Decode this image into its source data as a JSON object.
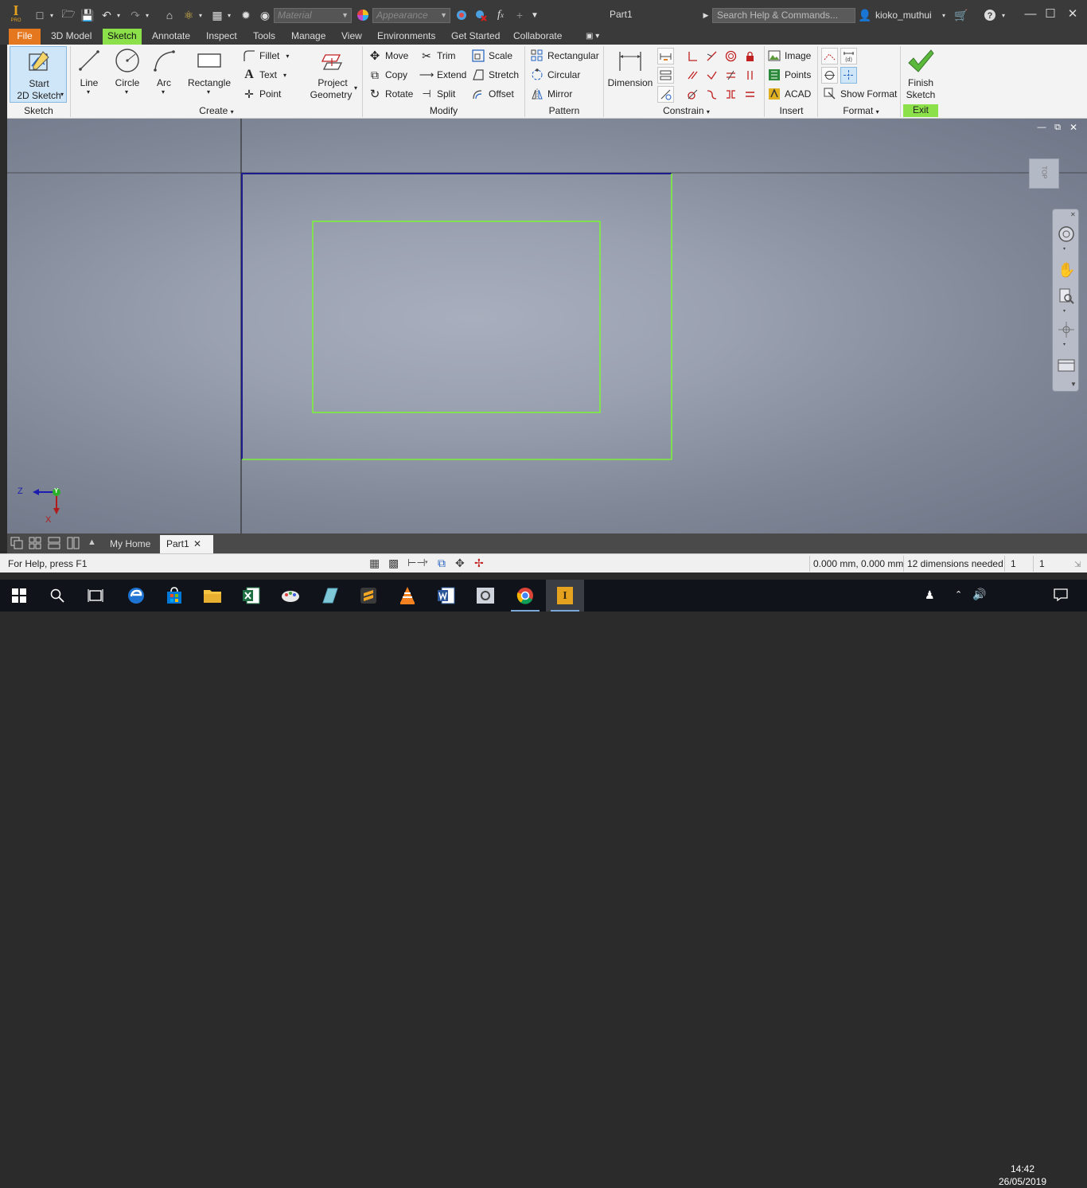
{
  "app": {
    "logo_text": "I",
    "logo_sub": "PRO",
    "title": "Part1",
    "material_placeholder": "Material",
    "appearance_placeholder": "Appearance",
    "fx_label": "f",
    "search_placeholder": "Search Help & Commands...",
    "username": "kioko_muthui"
  },
  "menu_tabs": [
    "File",
    "3D Model",
    "Sketch",
    "Annotate",
    "Inspect",
    "Tools",
    "Manage",
    "View",
    "Environments",
    "Get Started",
    "Collaborate"
  ],
  "ribbon": {
    "sketch_panel": {
      "start_label_1": "Start",
      "start_label_2": "2D Sketch",
      "title": "Sketch"
    },
    "create_panel": {
      "line": "Line",
      "circle": "Circle",
      "arc": "Arc",
      "rectangle": "Rectangle",
      "fillet": "Fillet",
      "text": "Text",
      "point": "Point",
      "project_1": "Project",
      "project_2": "Geometry",
      "title": "Create"
    },
    "modify_panel": {
      "move": "Move",
      "copy": "Copy",
      "rotate": "Rotate",
      "trim": "Trim",
      "extend": "Extend",
      "split": "Split",
      "scale": "Scale",
      "stretch": "Stretch",
      "offset": "Offset",
      "title": "Modify"
    },
    "pattern_panel": {
      "rectangular": "Rectangular",
      "circular": "Circular",
      "mirror": "Mirror",
      "title": "Pattern"
    },
    "constrain_panel": {
      "dimension": "Dimension",
      "title": "Constrain"
    },
    "insert_panel": {
      "image": "Image",
      "points": "Points",
      "acad": "ACAD",
      "title": "Insert"
    },
    "format_panel": {
      "show_format": "Show Format",
      "title": "Format"
    },
    "exit_panel": {
      "finish_1": "Finish",
      "finish_2": "Sketch",
      "title": "Exit"
    }
  },
  "viewcube": {
    "face_label": "TOP"
  },
  "triad": {
    "z_label": "Z",
    "y_label": "Y",
    "x_label": "X"
  },
  "doc_tabs": [
    "My Home",
    "Part1"
  ],
  "status": {
    "help": "For Help, press F1",
    "coords": "0.000 mm, 0.000 mm",
    "dims": "12 dimensions needed",
    "count1": "1",
    "count2": "1"
  },
  "clock": {
    "time": "14:42",
    "date": "26/05/2019"
  },
  "colors": {
    "file_tab": "#e5771e",
    "active_tab": "#8ce04a",
    "sketch_green": "#7cf03a",
    "sketch_blue": "#1c1c8c"
  }
}
